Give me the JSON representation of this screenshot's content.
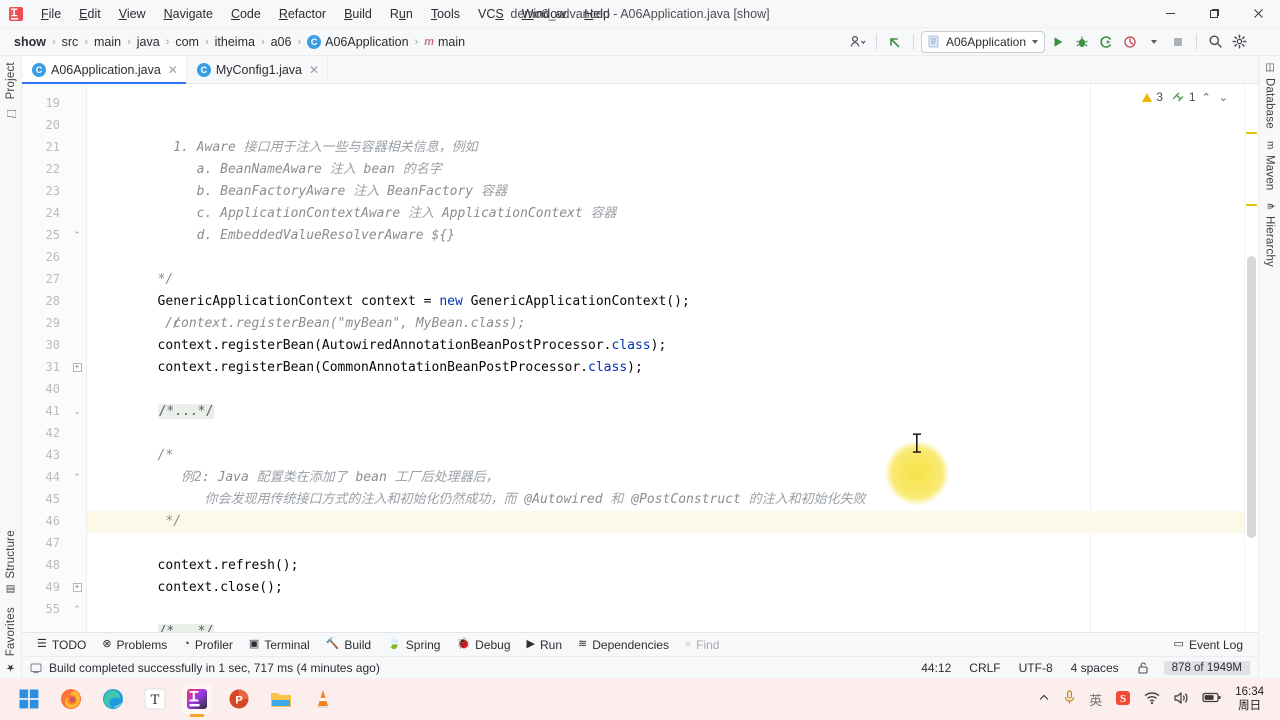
{
  "window": {
    "title": "demo6_advanced - A06Application.java [show]",
    "minimize": "–",
    "maximize": "▢",
    "close": "✕"
  },
  "menu": {
    "items": [
      {
        "label": "File"
      },
      {
        "label": "Edit"
      },
      {
        "label": "View"
      },
      {
        "label": "Navigate"
      },
      {
        "label": "Code"
      },
      {
        "label": "Refactor"
      },
      {
        "label": "Build"
      },
      {
        "label": "Run"
      },
      {
        "label": "Tools"
      },
      {
        "label": "VCS"
      },
      {
        "label": "Window"
      },
      {
        "label": "Help"
      }
    ]
  },
  "breadcrumb": {
    "items": [
      "show",
      "src",
      "main",
      "java",
      "com",
      "itheima",
      "a06",
      "A06Application",
      "main"
    ],
    "separator": "›"
  },
  "toolbar": {
    "run_config": "A06Application",
    "icons": [
      {
        "name": "profile-dropdown-icon",
        "glyph": "⚙"
      },
      {
        "name": "update-project-icon",
        "glyph": "↖"
      },
      {
        "name": "run-icon",
        "glyph": "▶"
      },
      {
        "name": "debug-icon",
        "glyph": "🐞"
      },
      {
        "name": "run-with-coverage-icon",
        "glyph": "▶"
      },
      {
        "name": "profiler-run-icon",
        "glyph": "◴"
      },
      {
        "name": "stop-icon",
        "glyph": "■"
      },
      {
        "name": "search-everywhere-icon",
        "glyph": "⌕"
      },
      {
        "name": "settings-gear-icon",
        "glyph": "⚙"
      },
      {
        "name": "ide-assistant-icon",
        "glyph": "◐"
      }
    ]
  },
  "tabs": [
    {
      "label": "A06Application.java",
      "active": true,
      "close": "✕",
      "icon": "java-class-icon",
      "letter": "C"
    },
    {
      "label": "MyConfig1.java",
      "active": false,
      "close": "✕",
      "icon": "java-class-icon",
      "letter": "C"
    }
  ],
  "stripes": {
    "left": [
      {
        "label": "Project",
        "icon": "folder-icon"
      },
      {
        "label": "Structure",
        "icon": "structure-icon"
      },
      {
        "label": "Favorites",
        "icon": "star-icon"
      }
    ],
    "right": [
      {
        "label": "Database",
        "icon": "database-icon"
      },
      {
        "label": "Maven",
        "icon": "maven-icon"
      },
      {
        "label": "Hierarchy",
        "icon": "hierarchy-icon"
      }
    ]
  },
  "inspections": {
    "warning_count": "3",
    "weak_warning_count": "1",
    "up_arrow": "⌃",
    "down_arrow": "⌄"
  },
  "editor": {
    "caret_line_index": 12,
    "lines": [
      {
        "num": "19",
        "fold": "",
        "indent": 10,
        "segments": [
          {
            "t": "1. Aware ",
            "c": "cmt"
          },
          {
            "t": "接口用于注入一些与容器相关信息，例如",
            "c": "cmt-cn"
          }
        ]
      },
      {
        "num": "20",
        "fold": "",
        "indent": 13,
        "segments": [
          {
            "t": "a. BeanNameAware ",
            "c": "cmt"
          },
          {
            "t": "注入",
            "c": "cmt-cn"
          },
          {
            "t": " bean ",
            "c": "cmt"
          },
          {
            "t": "的名字",
            "c": "cmt-cn"
          }
        ]
      },
      {
        "num": "21",
        "fold": "",
        "indent": 13,
        "segments": [
          {
            "t": "b. BeanFactoryAware ",
            "c": "cmt"
          },
          {
            "t": "注入",
            "c": "cmt-cn"
          },
          {
            "t": " BeanFactory ",
            "c": "cmt"
          },
          {
            "t": "容器",
            "c": "cmt-cn"
          }
        ]
      },
      {
        "num": "22",
        "fold": "",
        "indent": 13,
        "segments": [
          {
            "t": "c. ApplicationContextAware ",
            "c": "cmt"
          },
          {
            "t": "注入",
            "c": "cmt-cn"
          },
          {
            "t": " ApplicationContext ",
            "c": "cmt"
          },
          {
            "t": "容器",
            "c": "cmt-cn"
          }
        ]
      },
      {
        "num": "23",
        "fold": "",
        "indent": 13,
        "segments": [
          {
            "t": "d. EmbeddedValueResolverAware ${}",
            "c": "cmt"
          }
        ]
      },
      {
        "num": "24",
        "fold": "",
        "indent": 0,
        "segments": []
      },
      {
        "num": "25",
        "fold": "end",
        "indent": 8,
        "segments": [
          {
            "t": "*/",
            "c": "cmt"
          }
        ]
      },
      {
        "num": "26",
        "fold": "",
        "indent": 8,
        "segments": [
          {
            "t": "GenericApplicationContext context = ",
            "c": ""
          },
          {
            "t": "new",
            "c": "kw"
          },
          {
            "t": " GenericApplicationContext();",
            "c": ""
          }
        ]
      },
      {
        "num": "27",
        "fold": "",
        "indent": 8,
        "gutterComment": "//",
        "segments": [
          {
            "t": "  context.registerBean(\"myBean\", MyBean.class);",
            "c": "cmt"
          }
        ]
      },
      {
        "num": "28",
        "fold": "",
        "indent": 8,
        "segments": [
          {
            "t": "context.registerBean(AutowiredAnnotationBeanPostProcessor.",
            "c": ""
          },
          {
            "t": "class",
            "c": "kw"
          },
          {
            "t": ");",
            "c": ""
          }
        ]
      },
      {
        "num": "29",
        "fold": "",
        "indent": 8,
        "segments": [
          {
            "t": "context.registerBean(CommonAnnotationBeanPostProcessor.",
            "c": ""
          },
          {
            "t": "class",
            "c": "kw"
          },
          {
            "t": ");",
            "c": ""
          }
        ]
      },
      {
        "num": "30",
        "fold": "",
        "indent": 0,
        "segments": []
      },
      {
        "num": "31",
        "fold": "collapsed",
        "indent": 8,
        "segments": [
          {
            "t": "/*...*/",
            "c": "folded"
          }
        ]
      },
      {
        "num": "40",
        "fold": "",
        "indent": 0,
        "segments": []
      },
      {
        "num": "41",
        "fold": "start",
        "indent": 8,
        "segments": [
          {
            "t": "/*",
            "c": "cmt"
          }
        ]
      },
      {
        "num": "42",
        "fold": "",
        "indent": 11,
        "segments": [
          {
            "t": "例2",
            "c": "cmt-cn"
          },
          {
            "t": ": Java ",
            "c": "cmt"
          },
          {
            "t": "配置类在添加了",
            "c": "cmt-cn"
          },
          {
            "t": " bean ",
            "c": "cmt"
          },
          {
            "t": "工厂后处理器后，",
            "c": "cmt-cn"
          }
        ]
      },
      {
        "num": "43",
        "fold": "",
        "indent": 14,
        "segments": [
          {
            "t": "你会发现用传统接口方式的注入和初始化仍然成功，而",
            "c": "cmt-cn"
          },
          {
            "t": " @Autowired ",
            "c": "cmt"
          },
          {
            "t": "和",
            "c": "cmt-cn"
          },
          {
            "t": " @PostConstruct ",
            "c": "cmt"
          },
          {
            "t": "的注入和初始化失败",
            "c": "cmt-cn"
          }
        ]
      },
      {
        "num": "44",
        "fold": "end",
        "indent": 9,
        "caret": true,
        "segments": [
          {
            "t": "*/",
            "c": "cmt"
          }
        ]
      },
      {
        "num": "45",
        "fold": "",
        "indent": 0,
        "segments": []
      },
      {
        "num": "46",
        "fold": "",
        "indent": 8,
        "segments": [
          {
            "t": "context.refresh();",
            "c": ""
          }
        ]
      },
      {
        "num": "47",
        "fold": "",
        "indent": 8,
        "segments": [
          {
            "t": "context.close();",
            "c": ""
          }
        ]
      },
      {
        "num": "48",
        "fold": "",
        "indent": 0,
        "segments": []
      },
      {
        "num": "49",
        "fold": "collapsed",
        "indent": 8,
        "segments": [
          {
            "t": "/*...*/",
            "c": "folded"
          }
        ]
      },
      {
        "num": "55",
        "fold": "end",
        "indent": 6,
        "segments": [
          {
            "t": "}",
            "c": ""
          }
        ]
      }
    ]
  },
  "tool_windows": [
    {
      "label": "TODO",
      "icon": "todo-icon",
      "glyph": "☰",
      "dim": false
    },
    {
      "label": "Problems",
      "icon": "problems-icon",
      "glyph": "⊗",
      "dim": false
    },
    {
      "label": "Profiler",
      "icon": "profiler-icon",
      "glyph": "◔",
      "dim": false
    },
    {
      "label": "Terminal",
      "icon": "terminal-icon",
      "glyph": "▣",
      "dim": false
    },
    {
      "label": "Build",
      "icon": "build-hammer-icon",
      "glyph": "🔨",
      "dim": false
    },
    {
      "label": "Spring",
      "icon": "spring-leaf-icon",
      "glyph": "🍃",
      "dim": false
    },
    {
      "label": "Debug",
      "icon": "debug-bug-icon",
      "glyph": "🐞",
      "dim": false
    },
    {
      "label": "Run",
      "icon": "run-play-icon",
      "glyph": "▶",
      "dim": false
    },
    {
      "label": "Dependencies",
      "icon": "dependencies-icon",
      "glyph": "≋",
      "dim": false
    },
    {
      "label": "Find",
      "icon": "find-search-icon",
      "glyph": "⌕",
      "dim": true
    }
  ],
  "status_bar": {
    "build_icon": "build-status-icon",
    "message": "Build completed successfully in 1 sec, 717 ms (4 minutes ago)",
    "caret_position": "44:12",
    "line_separator": "CRLF",
    "encoding": "UTF-8",
    "indent": "4 spaces",
    "lock_icon": "lock-open-icon",
    "memory": "878 of 1949M",
    "event_log": "Event Log",
    "event_log_icon": "event-log-icon"
  },
  "taskbar": {
    "apps": [
      {
        "name": "windows-start-icon",
        "active": false,
        "running": false
      },
      {
        "name": "firefox-icon",
        "active": false,
        "running": true
      },
      {
        "name": "edge-icon",
        "active": false,
        "running": true
      },
      {
        "name": "typora-icon",
        "active": false,
        "running": true
      },
      {
        "name": "intellij-idea-icon",
        "active": true,
        "running": true
      },
      {
        "name": "powerpoint-icon",
        "active": false,
        "running": true
      },
      {
        "name": "file-explorer-icon",
        "active": false,
        "running": true
      },
      {
        "name": "vlc-icon",
        "active": false,
        "running": true
      }
    ],
    "tray": [
      {
        "name": "show-hidden-icons-chevron",
        "glyph": "⌃"
      },
      {
        "name": "microphone-icon",
        "glyph": "🎤"
      },
      {
        "name": "ime-chinese-icon",
        "glyph": "英"
      },
      {
        "name": "sogou-input-icon",
        "glyph": "S"
      },
      {
        "name": "wifi-icon",
        "glyph": "📶"
      },
      {
        "name": "volume-icon",
        "glyph": "🔊"
      },
      {
        "name": "battery-icon",
        "glyph": "🔋"
      }
    ],
    "time": "16:34",
    "date": "周日"
  }
}
